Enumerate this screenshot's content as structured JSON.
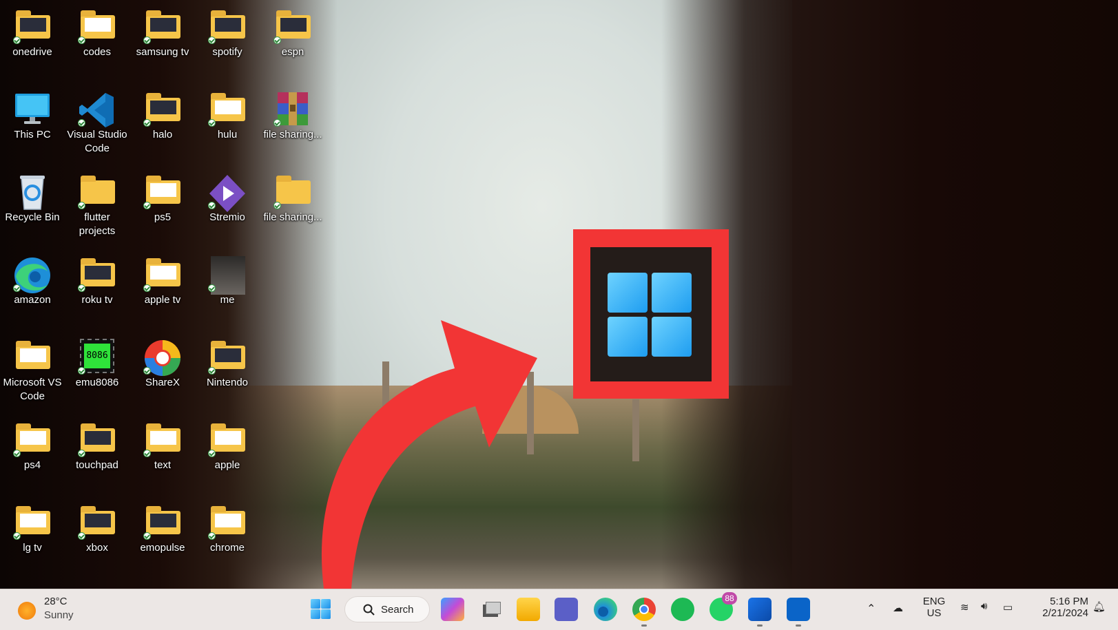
{
  "desktop": {
    "icons": [
      {
        "label": "onedrive",
        "icon": "folder-icon"
      },
      {
        "label": "codes",
        "icon": "folder-icon"
      },
      {
        "label": "samsung tv",
        "icon": "folder-icon"
      },
      {
        "label": "spotify",
        "icon": "folder-icon"
      },
      {
        "label": "espn",
        "icon": "folder-icon"
      },
      {
        "label": "This PC",
        "icon": "monitor-icon"
      },
      {
        "label": "Visual Studio Code",
        "icon": "vscode-icon"
      },
      {
        "label": "halo",
        "icon": "folder-icon"
      },
      {
        "label": "hulu",
        "icon": "folder-icon"
      },
      {
        "label": "file sharing...",
        "icon": "winrar-archive-icon"
      },
      {
        "label": "Recycle Bin",
        "icon": "recycle-bin-icon"
      },
      {
        "label": "flutter projects",
        "icon": "folder-icon"
      },
      {
        "label": "ps5",
        "icon": "folder-icon"
      },
      {
        "label": "Stremio",
        "icon": "stremio-icon"
      },
      {
        "label": "file sharing...",
        "icon": "folder-icon"
      },
      {
        "label": "amazon",
        "icon": "edge-icon"
      },
      {
        "label": "roku tv",
        "icon": "folder-icon"
      },
      {
        "label": "apple tv",
        "icon": "folder-icon"
      },
      {
        "label": "me",
        "icon": "photo-thumbnail-icon"
      },
      {
        "label": "Microsoft VS Code",
        "icon": "folder-icon"
      },
      {
        "label": "emu8086",
        "icon": "emu8086-chip-icon",
        "chip_text": "8086"
      },
      {
        "label": "ShareX",
        "icon": "sharex-icon"
      },
      {
        "label": "Nintendo",
        "icon": "folder-icon"
      },
      {
        "label": "ps4",
        "icon": "folder-icon"
      },
      {
        "label": "touchpad",
        "icon": "folder-icon"
      },
      {
        "label": "text",
        "icon": "folder-icon"
      },
      {
        "label": "apple",
        "icon": "folder-icon"
      },
      {
        "label": "lg tv",
        "icon": "folder-icon"
      },
      {
        "label": "xbox",
        "icon": "folder-icon"
      },
      {
        "label": "emopulse",
        "icon": "folder-icon"
      },
      {
        "label": "chrome",
        "icon": "folder-icon"
      }
    ]
  },
  "callout": {
    "icon": "windows-logo-icon",
    "box_color": "#f23535"
  },
  "taskbar": {
    "weather": {
      "temp": "28°C",
      "condition": "Sunny"
    },
    "search_label": "Search",
    "apps": [
      "copilot-pre-icon",
      "task-view-icon",
      "file-explorer-icon",
      "teams-icon",
      "edge-icon",
      "chrome-icon",
      "spotify-icon",
      "whatsapp-icon",
      "outlook-new-icon",
      "outlook-icon"
    ],
    "whatsapp_badge": "88",
    "tray": {
      "lang_top": "ENG",
      "lang_bottom": "US",
      "time": "5:16 PM",
      "date": "2/21/2024"
    }
  }
}
